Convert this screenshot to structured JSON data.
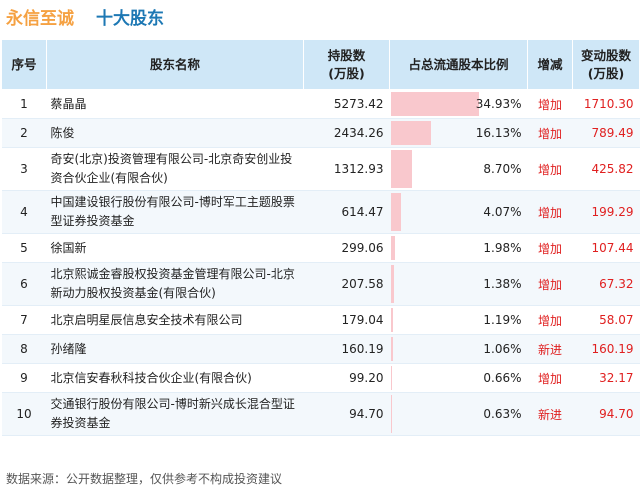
{
  "header": {
    "company": "永信至诚",
    "subtitle": "十大股东"
  },
  "table": {
    "columns": [
      "序号",
      "股东名称",
      "持股数\n(万股)",
      "占总流通股本比例",
      "增减",
      "变动股数\n(万股)"
    ],
    "rows": [
      {
        "rank": "1",
        "name": "蔡晶晶",
        "shares": "5273.42",
        "ratio": "34.93%",
        "ratio_value": 34.93,
        "change_type": "增加",
        "change": "1710.30"
      },
      {
        "rank": "2",
        "name": "陈俊",
        "shares": "2434.26",
        "ratio": "16.13%",
        "ratio_value": 16.13,
        "change_type": "增加",
        "change": "789.49"
      },
      {
        "rank": "3",
        "name": "奇安(北京)投资管理有限公司-北京奇安创业投资合伙企业(有限合伙)",
        "shares": "1312.93",
        "ratio": "8.70%",
        "ratio_value": 8.7,
        "change_type": "增加",
        "change": "425.82"
      },
      {
        "rank": "4",
        "name": "中国建设银行股份有限公司-博时军工主题股票型证券投资基金",
        "shares": "614.47",
        "ratio": "4.07%",
        "ratio_value": 4.07,
        "change_type": "增加",
        "change": "199.29"
      },
      {
        "rank": "5",
        "name": "徐国新",
        "shares": "299.06",
        "ratio": "1.98%",
        "ratio_value": 1.98,
        "change_type": "增加",
        "change": "107.44"
      },
      {
        "rank": "6",
        "name": "北京熙诚金睿股权投资基金管理有限公司-北京新动力股权投资基金(有限合伙)",
        "shares": "207.58",
        "ratio": "1.38%",
        "ratio_value": 1.38,
        "change_type": "增加",
        "change": "67.32"
      },
      {
        "rank": "7",
        "name": "北京启明星辰信息安全技术有限公司",
        "shares": "179.04",
        "ratio": "1.19%",
        "ratio_value": 1.19,
        "change_type": "增加",
        "change": "58.07"
      },
      {
        "rank": "8",
        "name": "孙绪隆",
        "shares": "160.19",
        "ratio": "1.06%",
        "ratio_value": 1.06,
        "change_type": "新进",
        "change": "160.19"
      },
      {
        "rank": "9",
        "name": "北京信安春秋科技合伙企业(有限合伙)",
        "shares": "99.20",
        "ratio": "0.66%",
        "ratio_value": 0.66,
        "change_type": "增加",
        "change": "32.17"
      },
      {
        "rank": "10",
        "name": "交通银行股份有限公司-博时新兴成长混合型证券投资基金",
        "shares": "94.70",
        "ratio": "0.63%",
        "ratio_value": 0.63,
        "change_type": "新进",
        "change": "94.70"
      }
    ]
  },
  "footer": {
    "note": "数据来源：公开数据整理，仅供参考不构成投资建议"
  },
  "colors": {
    "company": "#f5a142",
    "subtitle": "#1d78b4",
    "header_bg": "#cfe7f7",
    "bar": "#f9c8cd",
    "change": "#e02020"
  }
}
